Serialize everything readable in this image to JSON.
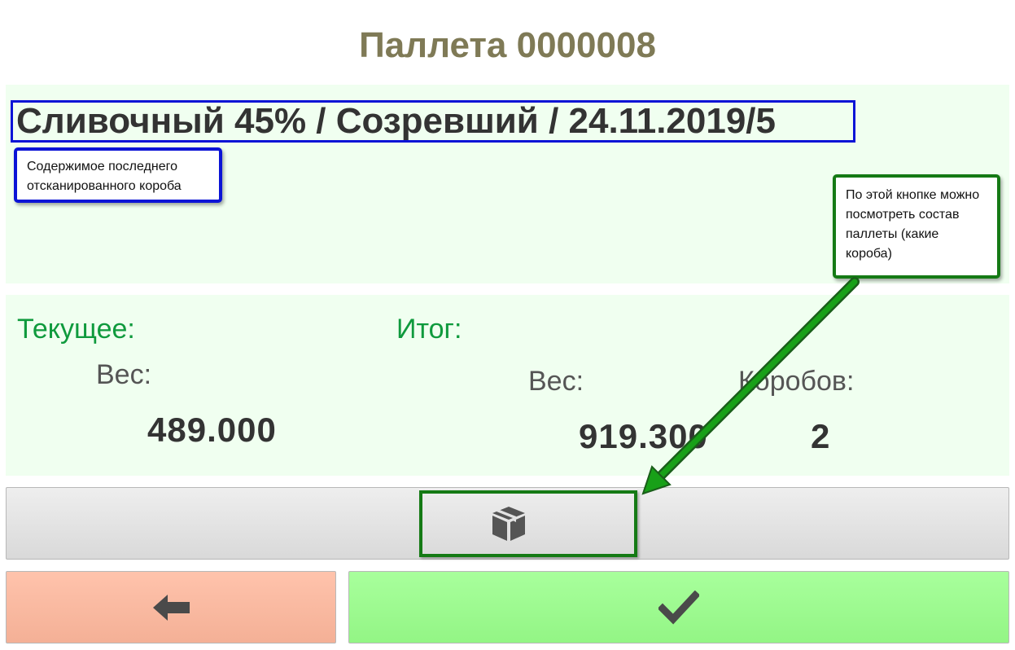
{
  "header": {
    "title": "Паллета 0000008"
  },
  "product": {
    "name": "Сливочный 45% / Созревший / 24.11.2019/5"
  },
  "annotations": {
    "last_box_note": "Содержимое последнего отсканированного короба",
    "contents_button_note": "По этой кнопке можно посмотреть состав паллеты (какие короба)"
  },
  "current": {
    "label": "Текущее:",
    "weight_label": "Вес:",
    "weight_value": "489.000"
  },
  "total": {
    "label": "Итог:",
    "weight_label": "Вес:",
    "weight_value": "919.300",
    "boxes_label": "Коробов:",
    "boxes_value": "2"
  },
  "buttons": {
    "contents_icon": "box-icon",
    "back_icon": "arrow-left-icon",
    "confirm_icon": "checkmark-icon"
  },
  "colors": {
    "title": "#7f7a56",
    "accent_green": "#0f9a3d",
    "panel_bg": "#f0fff0",
    "annotation_blue": "#0b14d6",
    "annotation_green": "#157a15",
    "back_button": "#f8b8a0",
    "confirm_button": "#9cf98e"
  }
}
